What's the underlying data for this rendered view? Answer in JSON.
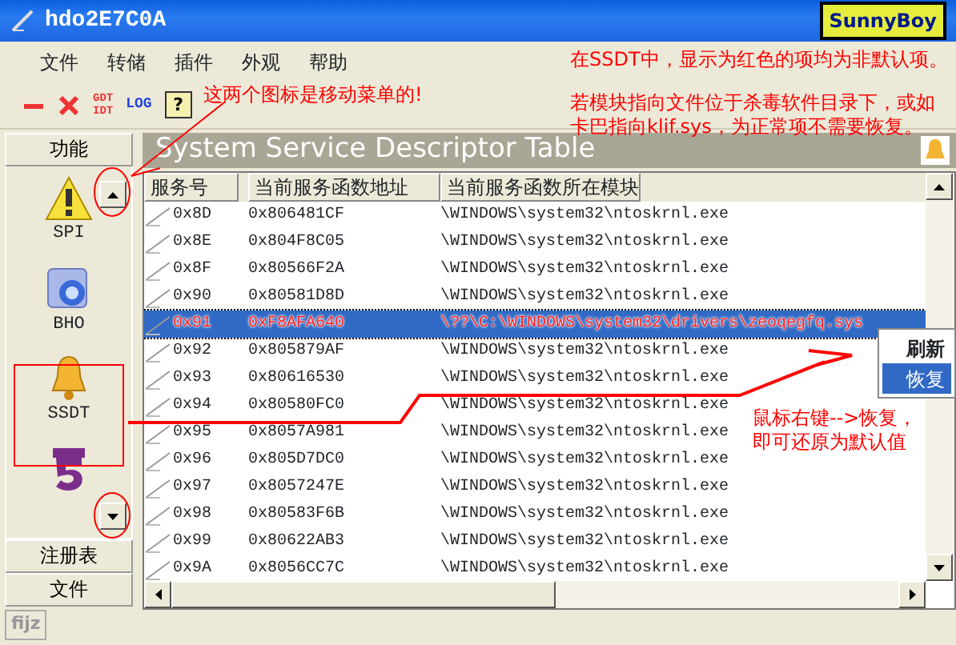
{
  "window": {
    "title": "hdo2E7C0A",
    "badge": "SunnyBoy"
  },
  "menu": [
    "文件",
    "转储",
    "插件",
    "外观",
    "帮助"
  ],
  "toolbar": [
    {
      "kind": "minus"
    },
    {
      "kind": "close"
    },
    {
      "kind": "stack",
      "label": "GDT",
      "label2": "IDT"
    },
    {
      "kind": "text",
      "label": "LOG"
    },
    {
      "kind": "help",
      "label": "?"
    }
  ],
  "notes": {
    "toolbar_note": "这两个图标是移动菜单的!",
    "top_lines": [
      "在SSDT中，显示为红色的项均为非默认项。",
      "若模块指向文件位于杀毒软件目录下，或如",
      "卡巴指向klif.sys，为正常项不需要恢复。"
    ],
    "menu_note": [
      "鼠标右键-->恢复，",
      "即可还原为默认值"
    ]
  },
  "sidebar": {
    "header": "功能",
    "items": [
      {
        "kind": "warning",
        "label": "SPI"
      },
      {
        "kind": "folder",
        "label": "BHO"
      },
      {
        "kind": "bell",
        "label": "SSDT"
      },
      {
        "kind": "book"
      }
    ],
    "buttons": [
      "注册表",
      "文件"
    ]
  },
  "panel": {
    "title": "System Service Descriptor Table"
  },
  "table": {
    "columns": [
      "服务号",
      "当前服务函数地址",
      "当前服务函数所在模块"
    ],
    "rows": [
      {
        "index": "0x8D",
        "address": "0x806481CF",
        "module": "\\WINDOWS\\system32\\ntoskrnl.exe",
        "selected": false,
        "modified": false
      },
      {
        "index": "0x8E",
        "address": "0x804F8C05",
        "module": "\\WINDOWS\\system32\\ntoskrnl.exe",
        "selected": false,
        "modified": false
      },
      {
        "index": "0x8F",
        "address": "0x80566F2A",
        "module": "\\WINDOWS\\system32\\ntoskrnl.exe",
        "selected": false,
        "modified": false
      },
      {
        "index": "0x90",
        "address": "0x80581D8D",
        "module": "\\WINDOWS\\system32\\ntoskrnl.exe",
        "selected": false,
        "modified": false
      },
      {
        "index": "0x91",
        "address": "0xF8AFA640",
        "module": "\\??\\C:\\WINDOWS\\system32\\drivers\\zeoqegfq.sys",
        "selected": true,
        "modified": true
      },
      {
        "index": "0x92",
        "address": "0x805879AF",
        "module": "\\WINDOWS\\system32\\ntoskrnl.exe",
        "selected": false,
        "modified": false
      },
      {
        "index": "0x93",
        "address": "0x80616530",
        "module": "\\WINDOWS\\system32\\ntoskrnl.exe",
        "selected": false,
        "modified": false
      },
      {
        "index": "0x94",
        "address": "0x80580FC0",
        "module": "\\WINDOWS\\system32\\ntoskrnl.exe",
        "selected": false,
        "modified": false
      },
      {
        "index": "0x95",
        "address": "0x8057A981",
        "module": "\\WINDOWS\\system32\\ntoskrnl.exe",
        "selected": false,
        "modified": false
      },
      {
        "index": "0x96",
        "address": "0x805D7DC0",
        "module": "\\WINDOWS\\system32\\ntoskrnl.exe",
        "selected": false,
        "modified": false
      },
      {
        "index": "0x97",
        "address": "0x8057247E",
        "module": "\\WINDOWS\\system32\\ntoskrnl.exe",
        "selected": false,
        "modified": false
      },
      {
        "index": "0x98",
        "address": "0x80583F6B",
        "module": "\\WINDOWS\\system32\\ntoskrnl.exe",
        "selected": false,
        "modified": false
      },
      {
        "index": "0x99",
        "address": "0x80622AB3",
        "module": "\\WINDOWS\\system32\\ntoskrnl.exe",
        "selected": false,
        "modified": false
      },
      {
        "index": "0x9A",
        "address": "0x8056CC7C",
        "module": "\\WINDOWS\\system32\\ntoskrnl.exe",
        "selected": false,
        "modified": false
      }
    ]
  },
  "context_menu": [
    {
      "label": "刷新",
      "default": true,
      "selected": false
    },
    {
      "label": "恢复",
      "default": false,
      "selected": true
    }
  ],
  "status_bar": "fijz"
}
